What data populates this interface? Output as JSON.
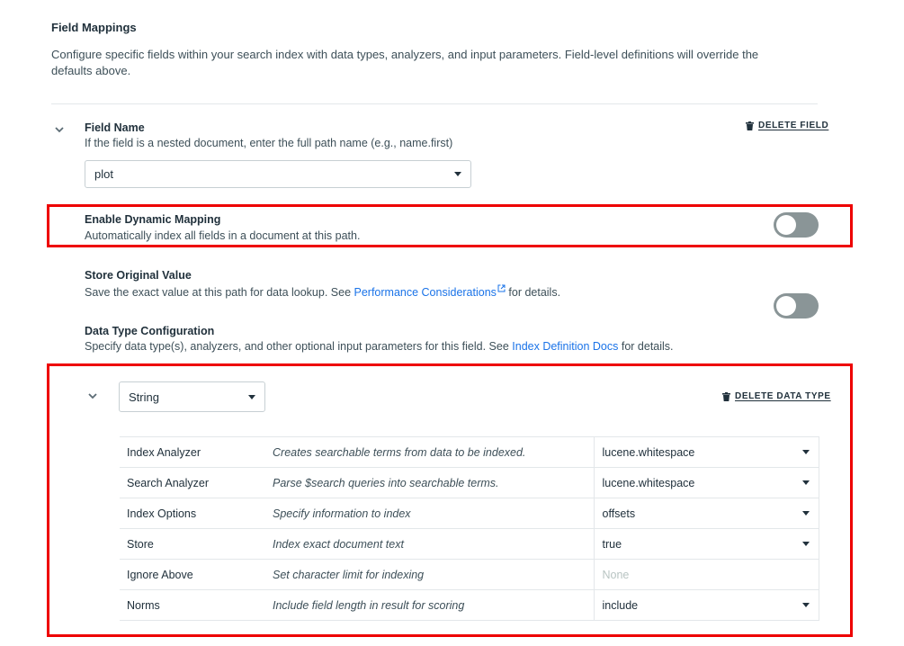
{
  "section": {
    "title": "Field Mappings",
    "description": "Configure specific fields within your search index with data types, analyzers, and input parameters. Field-level definitions will override the defaults above."
  },
  "field": {
    "label": "Field Name",
    "hint": "If the field is a nested document, enter the full path name (e.g., name.first)",
    "value": "plot",
    "delete_label": "DELETE FIELD"
  },
  "dynamic_mapping": {
    "label": "Enable Dynamic Mapping",
    "description": "Automatically index all fields in a document at this path.",
    "enabled": false
  },
  "store_original": {
    "label": "Store Original Value",
    "description_prefix": "Save the exact value at this path for data lookup. See ",
    "link": "Performance Considerations",
    "description_suffix": " for details.",
    "enabled": false
  },
  "data_type_config": {
    "label": "Data Type Configuration",
    "description_prefix": "Specify data type(s), analyzers, and other optional input parameters for this field. See ",
    "link": "Index Definition Docs",
    "description_suffix": " for details."
  },
  "data_type": {
    "selected": "String",
    "delete_label": "DELETE DATA TYPE"
  },
  "params": [
    {
      "name": "Index Analyzer",
      "description": "Creates searchable terms from data to be indexed.",
      "value": "lucene.whitespace",
      "dropdown": true
    },
    {
      "name": "Search Analyzer",
      "description": "Parse $search queries into searchable terms.",
      "value": "lucene.whitespace",
      "dropdown": true
    },
    {
      "name": "Index Options",
      "description": "Specify information to index",
      "value": "offsets",
      "dropdown": true
    },
    {
      "name": "Store",
      "description": "Index exact document text",
      "value": "true",
      "dropdown": true
    },
    {
      "name": "Ignore Above",
      "description": "Set character limit for indexing",
      "placeholder": "None",
      "dropdown": false
    },
    {
      "name": "Norms",
      "description": "Include field length in result for scoring",
      "value": "include",
      "dropdown": true
    }
  ],
  "colors": {
    "highlight": "#ee0000",
    "link": "#1a73e8",
    "toggle_off": "#8a9597"
  }
}
